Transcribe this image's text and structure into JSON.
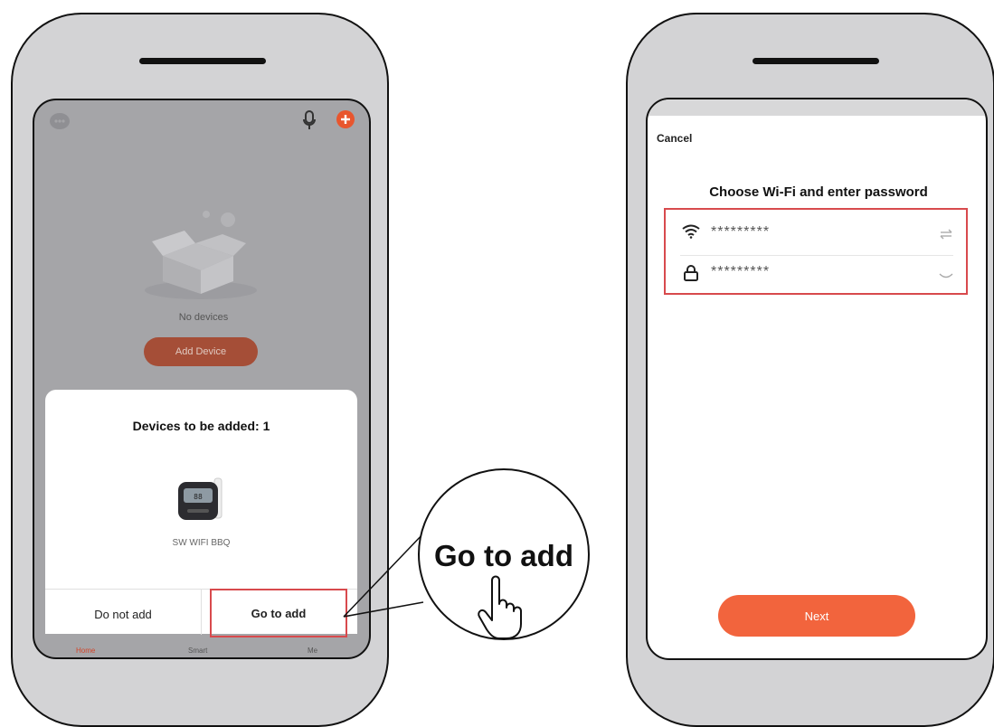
{
  "left_screen": {
    "empty_state_text": "No devices",
    "add_device_label": "Add Device",
    "sheet": {
      "title": "Devices to be added: 1",
      "device_name": "SW WIFI BBQ",
      "do_not_add_label": "Do not add",
      "go_to_add_label": "Go to add"
    },
    "tabs": [
      "Home",
      "Smart",
      "Me"
    ]
  },
  "callout": {
    "text": "Go to add"
  },
  "right_screen": {
    "cancel_label": "Cancel",
    "title": "Choose Wi-Fi and enter password",
    "wifi_name_value": "*********",
    "password_value": "*********",
    "next_label": "Next"
  },
  "colors": {
    "accent": "#f2643d",
    "highlight_border": "#d84a4d",
    "phone_body": "#d3d3d5",
    "dim_overlay": "#a5a5a8"
  },
  "icons": [
    "chat-icon",
    "microphone-icon",
    "plus-icon",
    "empty-box-icon",
    "wifi-icon",
    "lock-icon",
    "swap-icon",
    "eye-closed-icon",
    "hand-pointer-icon"
  ]
}
